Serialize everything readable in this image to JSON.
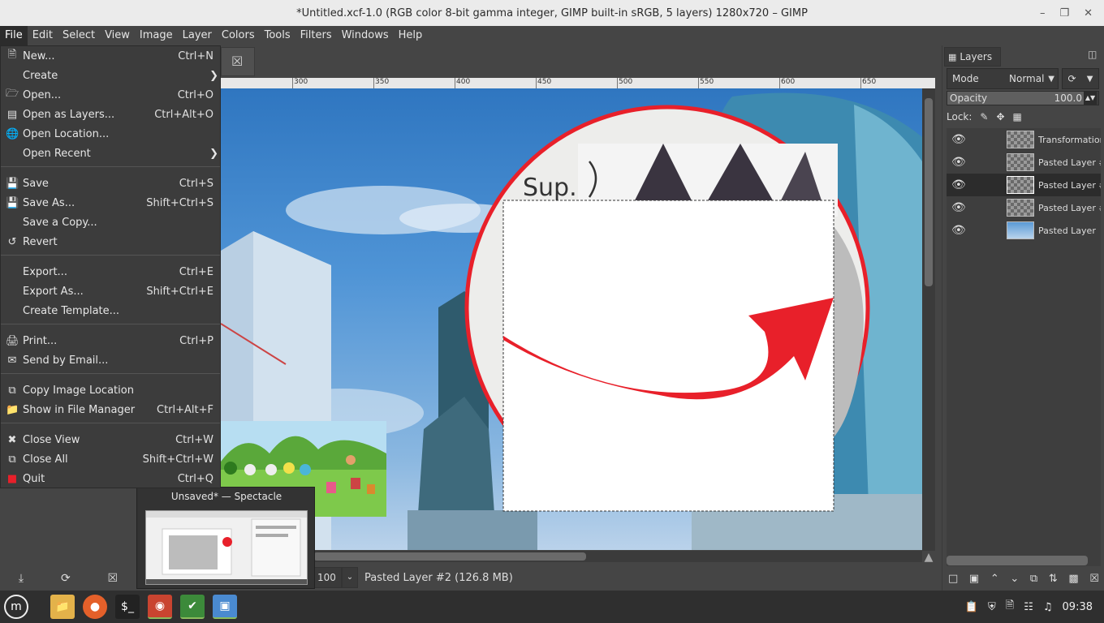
{
  "window": {
    "title": "*Untitled.xcf-1.0 (RGB color 8-bit gamma integer, GIMP built-in sRGB, 5 layers) 1280x720 – GIMP",
    "controls": [
      "minimize",
      "maximize",
      "close"
    ]
  },
  "menubar": [
    "File",
    "Edit",
    "Select",
    "View",
    "Image",
    "Layer",
    "Colors",
    "Tools",
    "Filters",
    "Windows",
    "Help"
  ],
  "file_menu": [
    {
      "label": "New...",
      "shortcut": "Ctrl+N",
      "icon": "new-icon"
    },
    {
      "label": "Create",
      "shortcut": "",
      "submenu": true
    },
    {
      "label": "Open...",
      "shortcut": "Ctrl+O",
      "icon": "open-icon"
    },
    {
      "label": "Open as Layers...",
      "shortcut": "Ctrl+Alt+O",
      "icon": "open-layers-icon"
    },
    {
      "label": "Open Location...",
      "shortcut": "",
      "icon": "globe-icon"
    },
    {
      "label": "Open Recent",
      "shortcut": "",
      "submenu": true
    },
    {
      "label": "Save",
      "shortcut": "Ctrl+S",
      "icon": "save-icon"
    },
    {
      "label": "Save As...",
      "shortcut": "Shift+Ctrl+S",
      "icon": "save-as-icon"
    },
    {
      "label": "Save a Copy...",
      "shortcut": ""
    },
    {
      "label": "Revert",
      "shortcut": "",
      "icon": "revert-icon"
    },
    {
      "label": "Export...",
      "shortcut": "Ctrl+E"
    },
    {
      "label": "Export As...",
      "shortcut": "Shift+Ctrl+E"
    },
    {
      "label": "Create Template...",
      "shortcut": ""
    },
    {
      "label": "Print...",
      "shortcut": "Ctrl+P",
      "icon": "print-icon"
    },
    {
      "label": "Send by Email...",
      "shortcut": "",
      "icon": "email-icon"
    },
    {
      "label": "Copy Image Location",
      "shortcut": "",
      "icon": "copy-icon"
    },
    {
      "label": "Show in File Manager",
      "shortcut": "Ctrl+Alt+F",
      "icon": "folder-icon"
    },
    {
      "label": "Close View",
      "shortcut": "Ctrl+W",
      "icon": "close-icon"
    },
    {
      "label": "Close All",
      "shortcut": "Shift+Ctrl+W",
      "icon": "close-all-icon"
    },
    {
      "label": "Quit",
      "shortcut": "Ctrl+Q",
      "icon": "quit-icon"
    }
  ],
  "ruler_labels": [
    "300",
    "350",
    "400",
    "450",
    "500",
    "550",
    "600",
    "650"
  ],
  "canvas": {
    "image_text": "Sup.",
    "accent_red": "#e8202a",
    "sky": "#4f94d6"
  },
  "status": {
    "zoom": "100 %",
    "message": "Pasted Layer #2 (126.8 MB)"
  },
  "layers_panel": {
    "tab": "Layers",
    "mode_label": "Mode",
    "mode_value": "Normal",
    "opacity_label": "Opacity",
    "opacity_value": "100.0",
    "lock_label": "Lock:",
    "layers": [
      {
        "name": "Transformation",
        "selected": false
      },
      {
        "name": "Pasted Layer #",
        "selected": false
      },
      {
        "name": "Pasted Layer #",
        "selected": true
      },
      {
        "name": "Pasted Layer #",
        "selected": false
      },
      {
        "name": "Pasted Layer",
        "selected": false
      }
    ]
  },
  "spectacle_preview": {
    "title": "Unsaved* — Spectacle"
  },
  "taskbar": {
    "apps": [
      "mint-menu",
      "files",
      "firefox",
      "terminal",
      "gimp",
      "shield",
      "spectacle"
    ],
    "clock": "09:38"
  }
}
